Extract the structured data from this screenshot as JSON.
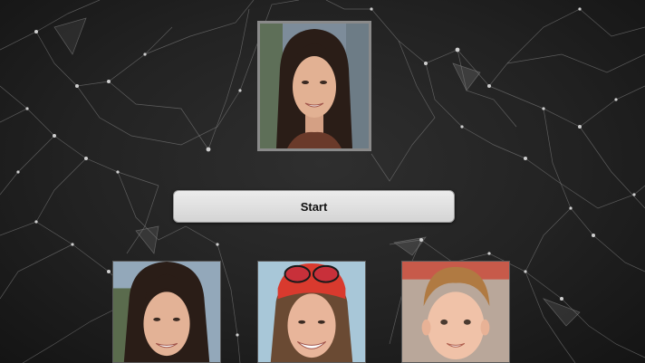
{
  "start_button": {
    "label": "Start"
  },
  "colors": {
    "background": "#262626",
    "network_lines": "#8c8c8c",
    "button_fill": "#e0e0e0",
    "target_frame": "#8a8a8a"
  },
  "images": {
    "target": "face-photo-woman-dark-hair",
    "choices": [
      "face-photo-woman-dark-hair",
      "face-photo-woman-red-cap-sunglasses",
      "face-photo-young-boy"
    ]
  }
}
